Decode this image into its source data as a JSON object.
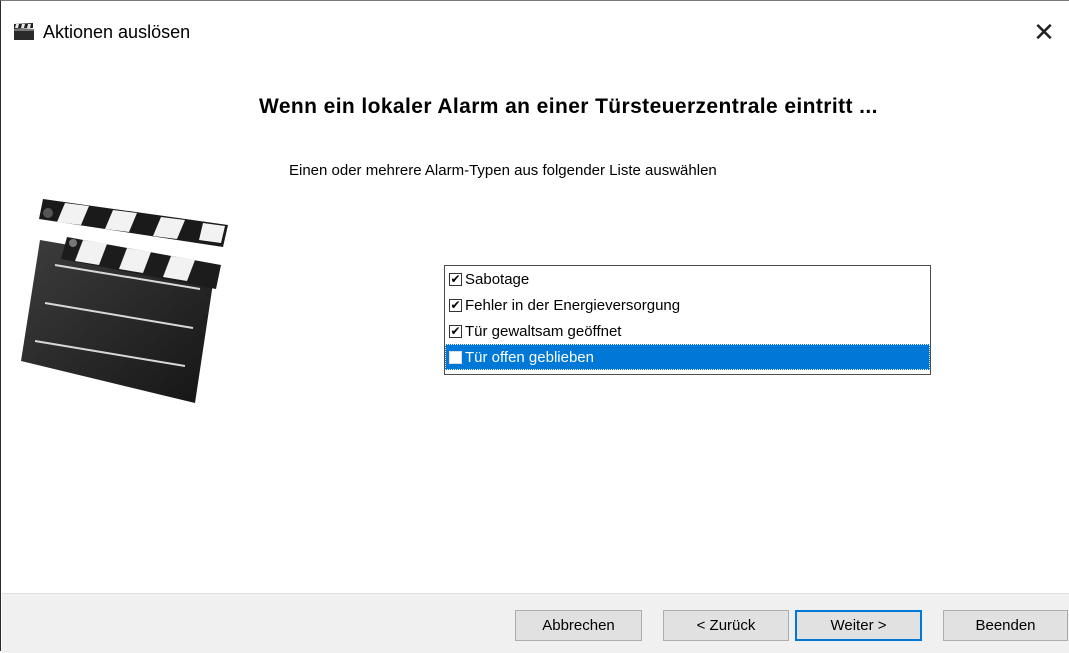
{
  "window": {
    "title": "Aktionen auslösen",
    "icon": "clapperboard-icon",
    "close_label": "✕"
  },
  "main": {
    "heading": "Wenn ein lokaler Alarm an einer Türsteuerzentrale eintritt ...",
    "subheading": "Einen oder mehrere Alarm-Typen aus folgender Liste auswählen",
    "illustration": "clapperboard-icon"
  },
  "alarm_list": {
    "items": [
      {
        "label": "Sabotage",
        "checked": true,
        "selected": false
      },
      {
        "label": "Fehler in der Energieversorgung",
        "checked": true,
        "selected": false
      },
      {
        "label": "Tür gewaltsam geöffnet",
        "checked": true,
        "selected": false
      },
      {
        "label": "Tür offen geblieben",
        "checked": false,
        "selected": true
      }
    ],
    "selection_color": "#0078d7"
  },
  "buttons": {
    "cancel": "Abbrechen",
    "back": "< Zurück",
    "next": "Weiter >",
    "finish": "Beenden"
  }
}
